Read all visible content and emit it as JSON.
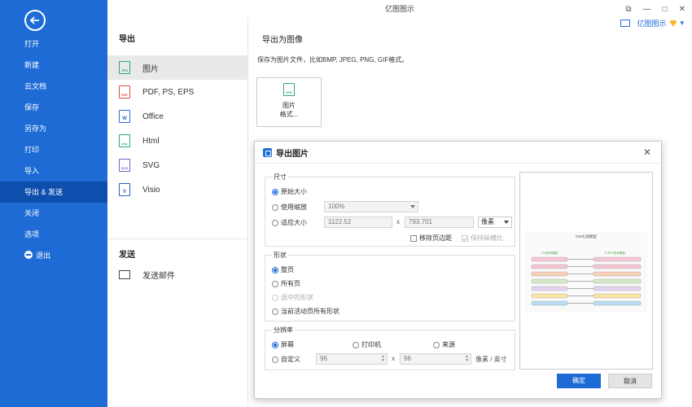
{
  "app": {
    "title": "亿图图示"
  },
  "window": {
    "restore": "⧉",
    "minimize": "—",
    "maximize": "□",
    "close": "✕"
  },
  "user": {
    "name": "亿图图示",
    "dropdown_arrow": "▾"
  },
  "sidebar": {
    "items": [
      {
        "label": "打开"
      },
      {
        "label": "新建"
      },
      {
        "label": "云文档"
      },
      {
        "label": "保存"
      },
      {
        "label": "另存为"
      },
      {
        "label": "打印"
      },
      {
        "label": "导入"
      },
      {
        "label": "导出 & 发送"
      },
      {
        "label": "关闭"
      },
      {
        "label": "选项"
      },
      {
        "label": "退出"
      }
    ],
    "active_index": 7
  },
  "mid": {
    "export_title": "导出",
    "formats": [
      {
        "label": "图片",
        "icon": "jpg-icon",
        "badge": "JPG",
        "color": "#2aa876"
      },
      {
        "label": "PDF, PS, EPS",
        "icon": "pdf-icon",
        "badge": "PDF",
        "color": "#e24c3f"
      },
      {
        "label": "Office",
        "icon": "word-icon",
        "badge": "W",
        "color": "#2b6fd6"
      },
      {
        "label": "Html",
        "icon": "html-icon",
        "badge": "HTML",
        "color": "#2aa876"
      },
      {
        "label": "SVG",
        "icon": "svg-icon",
        "badge": "SVG",
        "color": "#7b5cc4"
      },
      {
        "label": "Visio",
        "icon": "visio-icon",
        "badge": "V",
        "color": "#2b5bb8"
      }
    ],
    "send_title": "发送",
    "send_mail": "发送邮件"
  },
  "content": {
    "title": "导出为图像",
    "desc": "保存为图片文件，比如BMP, JPEG, PNG, GIF格式。",
    "tile_line1": "图片",
    "tile_line2": "格式...",
    "tile_badge": "JPG"
  },
  "dialog": {
    "title": "导出图片",
    "close": "✕",
    "size": {
      "legend": "尺寸",
      "original": "原始大小",
      "use_zoom": "使用缩放",
      "zoom_value": "100%",
      "fit": "适应大小",
      "width": "1122.52",
      "times": "x",
      "height": "793.701",
      "unit": "像素",
      "remove_margin": "移除页边距",
      "keep_ratio": "保持纵横比"
    },
    "shape": {
      "legend": "形状",
      "whole_page": "整页",
      "all_pages": "所有页",
      "selected": "选中的形状",
      "current_page_all": "当前活动页所有形状"
    },
    "resolution": {
      "legend": "分辨率",
      "screen": "屏幕",
      "printer": "打印机",
      "source": "来源",
      "custom": "自定义",
      "x_value": "96",
      "times": "x",
      "y_value": "96",
      "unit": "像素 / 英寸"
    },
    "preview_title": "OSI七层模型",
    "preview_left_header": "OSI参考模型",
    "preview_right_header": "TCP/IP参考模型",
    "preview_layer_colors": [
      "#f4c7d3",
      "#f4c7d3",
      "#f7d2b8",
      "#d6e8c8",
      "#e3d3ef",
      "#fbe6a6",
      "#b9ddf2"
    ],
    "ok": "确定",
    "cancel": "取消"
  }
}
